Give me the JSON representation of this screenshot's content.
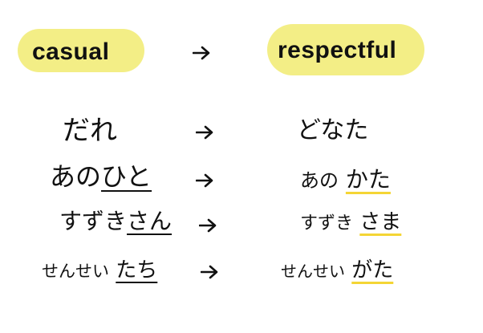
{
  "header": {
    "left_label": "casual",
    "right_label": "respectful"
  },
  "rows": [
    {
      "casual": {
        "prefix": "",
        "marked": "だれ",
        "suffix": ""
      },
      "respectful": {
        "prefix": "",
        "marked": "どなた",
        "suffix": ""
      }
    },
    {
      "casual": {
        "prefix": "あの",
        "marked": "ひと",
        "suffix": ""
      },
      "respectful": {
        "prefix": "あの",
        "marked": "かた",
        "suffix": ""
      }
    },
    {
      "casual": {
        "prefix": "すずき",
        "marked": "さん",
        "suffix": ""
      },
      "respectful": {
        "prefix": "すずき",
        "marked": "さま",
        "suffix": ""
      }
    },
    {
      "casual": {
        "prefix": "せんせい",
        "marked": "たち",
        "suffix": ""
      },
      "respectful": {
        "prefix": "せんせい",
        "marked": "がた",
        "suffix": ""
      }
    }
  ],
  "colors": {
    "highlight": "#f3ee86",
    "underline_respectful": "#f4d535",
    "ink": "#111111"
  },
  "icons": {
    "arrow": "right-arrow-icon"
  }
}
